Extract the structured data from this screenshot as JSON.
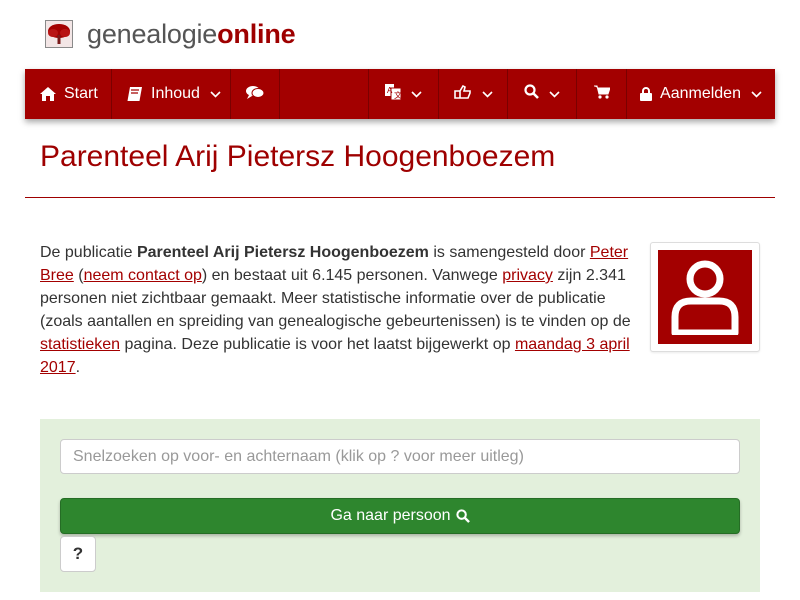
{
  "brand": {
    "name_part1": "genealogie",
    "name_part2": "online"
  },
  "nav": {
    "start": "Start",
    "contents": "Inhoud",
    "login": "Aanmelden",
    "icons": [
      "home-icon",
      "book-icon",
      "chat-icon",
      "translate-icon",
      "share-icon",
      "search-icon",
      "cart-icon",
      "lock-icon"
    ]
  },
  "page": {
    "title": "Parenteel Arij Pietersz Hoogenboezem"
  },
  "intro": {
    "t1": "De publicatie ",
    "pub": "Parenteel Arij Pietersz Hoogenboezem",
    "t2": " is samengesteld door ",
    "author": "Peter Bree",
    "t3": " (",
    "contact": "neem contact op",
    "t4": ") en bestaat uit 6.145 personen. Vanwege ",
    "privacy": "privacy",
    "t5": " zijn 2.341 personen niet zichtbaar gemaakt. Meer statistische informatie over de publicatie (zoals aantallen en spreiding van genealogische gebeurtenissen) is te vinden op de ",
    "stats": "statistieken",
    "t6": " pagina. Deze publicatie is voor het laatst bijgewerkt op ",
    "date": "maandag 3 april 2017",
    "t7": "."
  },
  "search": {
    "placeholder": "Snelzoeken op voor- en achternaam (klik op ? voor meer uitleg)",
    "button": "Ga naar persoon",
    "help": "?"
  },
  "colors": {
    "brand": "#a30000",
    "panel": "#e3f0dc",
    "button": "#2e862e"
  }
}
